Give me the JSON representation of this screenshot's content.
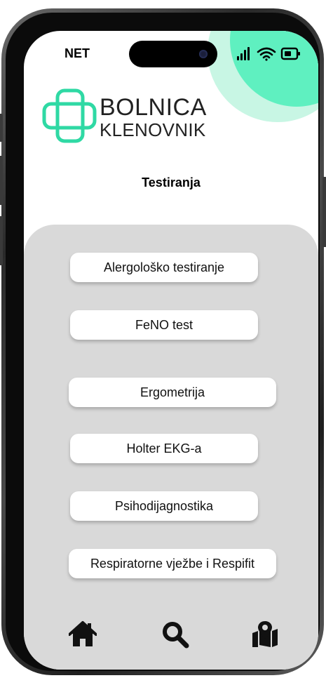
{
  "status_bar": {
    "carrier": "NET",
    "icons": [
      "signal-icon",
      "wifi-icon",
      "battery-icon"
    ]
  },
  "brand": {
    "name": "BOLNICA",
    "subtitle": "KLENOVNIK",
    "accent_color": "#5ff0c0",
    "logo_icon": "medical-cross-icon"
  },
  "page": {
    "title": "Testiranja"
  },
  "tests": [
    {
      "label": "Alergološko testiranje"
    },
    {
      "label": "FeNO test"
    },
    {
      "label": "Ergometrija"
    },
    {
      "label": "Holter EKG-a"
    },
    {
      "label": "Psihodijagnostika"
    },
    {
      "label": "Respiratorne vježbe i Respifit"
    }
  ],
  "bottom_nav": {
    "items": [
      {
        "icon": "home-icon"
      },
      {
        "icon": "search-icon"
      },
      {
        "icon": "map-location-icon"
      }
    ]
  },
  "colors": {
    "panel": "#d9d9d9",
    "accent": "#5ff0c0",
    "accent_light": "#c8f6e4"
  }
}
